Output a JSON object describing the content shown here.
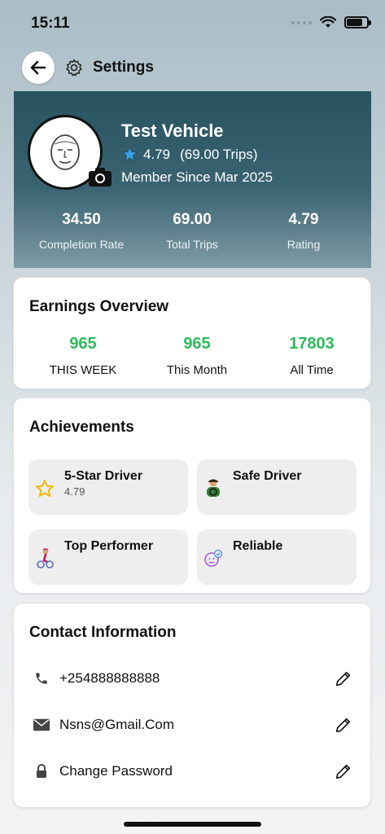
{
  "status_bar": {
    "time": "15:11",
    "battery_level": 0.8
  },
  "nav": {
    "title": "Settings",
    "icons": [
      "back-arrow-icon",
      "gear-icon"
    ]
  },
  "profile": {
    "name": "Test Vehicle",
    "rating": "4.79",
    "trips": "(69.00 Trips)",
    "member_since": "Member Since Mar 2025",
    "stats": [
      {
        "value": "34.50",
        "label": "Completion Rate"
      },
      {
        "value": "69.00",
        "label": "Total Trips"
      },
      {
        "value": "4.79",
        "label": "Rating"
      }
    ],
    "colors": {
      "header_top": "#27525f",
      "header_bottom": "#7f9ba6",
      "star": "#3aa0e0"
    }
  },
  "earnings": {
    "title": "Earnings Overview",
    "items": [
      {
        "value": "965",
        "label": "THIS WEEK"
      },
      {
        "value": "965",
        "label": "This Month"
      },
      {
        "value": "17803",
        "label": "All Time"
      }
    ],
    "value_color": "#2dbb5a"
  },
  "achievements": {
    "title": "Achievements",
    "items": [
      {
        "name": "5-Star Driver",
        "sub": "4.79",
        "icon": "star-outline-icon"
      },
      {
        "name": "Safe Driver",
        "sub": "",
        "icon": "driver-icon"
      },
      {
        "name": "Top Performer",
        "sub": "",
        "icon": "cyclist-icon"
      },
      {
        "name": "Reliable",
        "sub": "",
        "icon": "verified-face-icon"
      }
    ]
  },
  "contact": {
    "title": "Contact Information",
    "rows": [
      {
        "text": "+254888888888",
        "icon": "phone-icon"
      },
      {
        "text": "Nsns@Gmail.Com",
        "icon": "mail-icon"
      },
      {
        "text": "Change Password",
        "icon": "lock-icon"
      }
    ]
  }
}
